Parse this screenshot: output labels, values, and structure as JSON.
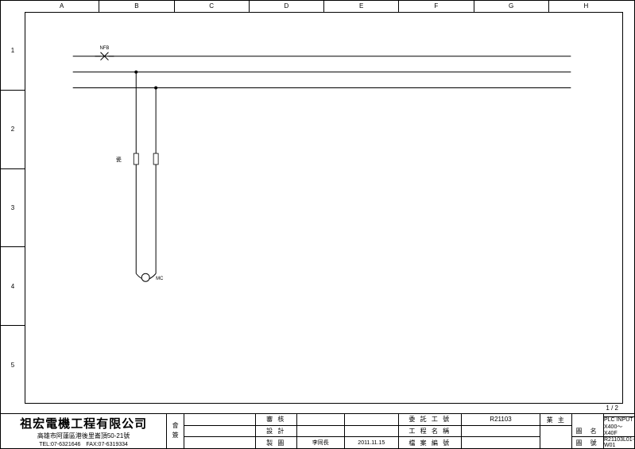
{
  "frame": {
    "columns": [
      "A",
      "B",
      "C",
      "D",
      "E",
      "F",
      "G",
      "H"
    ],
    "rows": [
      "1",
      "2",
      "3",
      "4",
      "5"
    ]
  },
  "title_block": {
    "company_name": "祖宏電機工程有限公司",
    "address": "高雄市阿蓮區港後里崙頂50-21號",
    "phone": "TEL:07-6321646　FAX:07-6319334",
    "seal_label": "會簽",
    "rows": {
      "r1": {
        "role": "審 核",
        "person": "",
        "date": "",
        "field": "委 託 工 號"
      },
      "r2": {
        "role": "設 計",
        "person": "",
        "date": "",
        "field": "工 程 名 稱"
      },
      "r3": {
        "role": "製 圖",
        "person": "李同長",
        "date": "2011.11.15",
        "field": "檔 案 編 號"
      }
    },
    "proj_no": "R21103",
    "owner_lbl": "業 主",
    "owner": "",
    "sheet_name_lbl": "圖 名",
    "sheet_name": "PLC INPUT X400～X40F",
    "drawing_no_lbl": "圖 號",
    "drawing_no": "R21103L01-W01",
    "page": "1 / 2"
  },
  "schematic": {
    "breaker_label": "NFB",
    "fuse_label": "瓷",
    "output_label": "MC"
  }
}
